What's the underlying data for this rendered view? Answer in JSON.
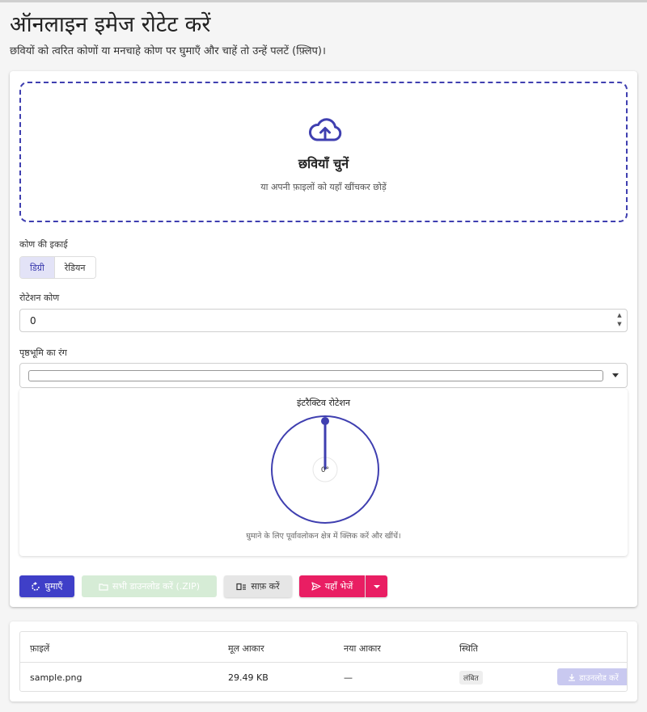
{
  "header": {
    "title": "ऑनलाइन इमेज रोटेट करें",
    "subtitle": "छवियों को त्वरित कोणों या मनचाहे कोण पर घुमाएँ और चाहें तो उन्हें पलटें (फ़्लिप)।"
  },
  "dropzone": {
    "title": "छवियाँ चुनें",
    "hint": "या अपनी फ़ाइलों को यहाँ खींचकर छोड़ें"
  },
  "angle_unit": {
    "label": "कोण की इकाई",
    "options": [
      "डिग्री",
      "रेडियन"
    ],
    "selected": "डिग्री"
  },
  "rotation_angle": {
    "label": "रोटेशन कोण",
    "value": "0"
  },
  "background_color": {
    "label": "पृष्ठभूमि का रंग",
    "value": "#ffffff"
  },
  "preview": {
    "title": "इंटरैक्टिव रोटेशन",
    "angle_display": "0°",
    "hint": "घुमाने के लिए पूर्वावलोकन क्षेत्र में क्लिक करें और खींचें।"
  },
  "actions": {
    "rotate": "घुमाएँ",
    "download_zip": "सभी डाउनलोड करें (.ZIP)",
    "clear": "साफ़ करें",
    "send": "यहाँ भेजें"
  },
  "files_table": {
    "headers": [
      "फ़ाइलें",
      "मूल आकार",
      "नया आकार",
      "स्थिति"
    ],
    "rows": [
      {
        "name": "sample.png",
        "original_size": "29.49 KB",
        "new_size": "—",
        "status": "लंबित",
        "action": "डाउनलोड करें"
      }
    ]
  },
  "colors": {
    "primary": "#3f3fc8",
    "accent": "#e91e63",
    "success_light": "#d6ecd6"
  }
}
